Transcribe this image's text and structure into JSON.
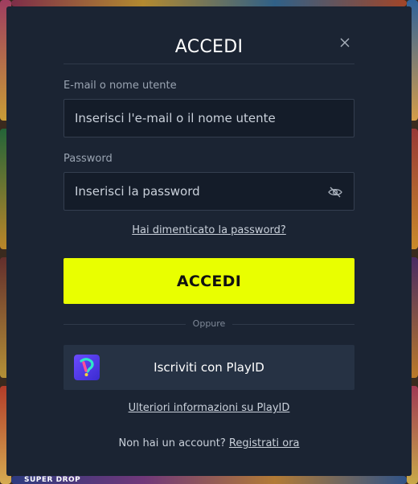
{
  "modal": {
    "title": "ACCEDI",
    "close_icon": "close-icon"
  },
  "form": {
    "email_label": "E-mail o nome utente",
    "email_placeholder": "Inserisci l'e-mail o il nome utente",
    "email_value": "",
    "password_label": "Password",
    "password_placeholder": "Inserisci la password",
    "password_value": "",
    "password_toggle_icon": "eye-slash-icon",
    "forgot_link": "Hai dimenticato la password?",
    "submit_label": "ACCEDI"
  },
  "divider": {
    "text": "Oppure"
  },
  "playid": {
    "button_label": "Iscriviti con PlayID",
    "logo_icon": "playid-logo-icon",
    "info_link": "Ulteriori informazioni su PlayID"
  },
  "signup": {
    "prompt": "Non hai un account?",
    "link": "Registrati ora"
  },
  "background": {
    "label": "SUPER DROP"
  },
  "colors": {
    "modal_bg": "#1b2433",
    "accent": "#e9ff00",
    "field_bg": "#141c29",
    "playid_bg": "#263244"
  }
}
